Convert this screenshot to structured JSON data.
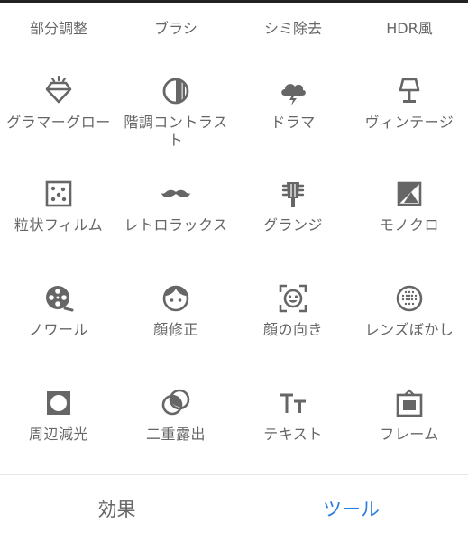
{
  "top_row": [
    "部分調整",
    "ブラシ",
    "シミ除去",
    "HDR風"
  ],
  "tools": [
    {
      "label": "グラマーグロー",
      "icon": "diamond-icon"
    },
    {
      "label": "階調コントラスト",
      "icon": "contrast-circle-icon"
    },
    {
      "label": "ドラマ",
      "icon": "storm-cloud-icon"
    },
    {
      "label": "ヴィンテージ",
      "icon": "lamp-icon"
    },
    {
      "label": "粒状フィルム",
      "icon": "grain-dice-icon"
    },
    {
      "label": "レトロラックス",
      "icon": "mustache-icon"
    },
    {
      "label": "グランジ",
      "icon": "guitar-head-icon"
    },
    {
      "label": "モノクロ",
      "icon": "mono-photo-icon"
    },
    {
      "label": "ノワール",
      "icon": "film-reel-icon"
    },
    {
      "label": "顔修正",
      "icon": "face-icon"
    },
    {
      "label": "顔の向き",
      "icon": "face-detect-icon"
    },
    {
      "label": "レンズぼかし",
      "icon": "lens-blur-icon"
    },
    {
      "label": "周辺減光",
      "icon": "vignette-icon"
    },
    {
      "label": "二重露出",
      "icon": "double-exposure-icon"
    },
    {
      "label": "テキスト",
      "icon": "text-icon"
    },
    {
      "label": "フレーム",
      "icon": "frame-icon"
    }
  ],
  "bottom": {
    "effects": "効果",
    "tools": "ツール"
  },
  "colors": {
    "icon": "#666666",
    "accent": "#2b7de0",
    "divider": "#e6e6e6"
  }
}
